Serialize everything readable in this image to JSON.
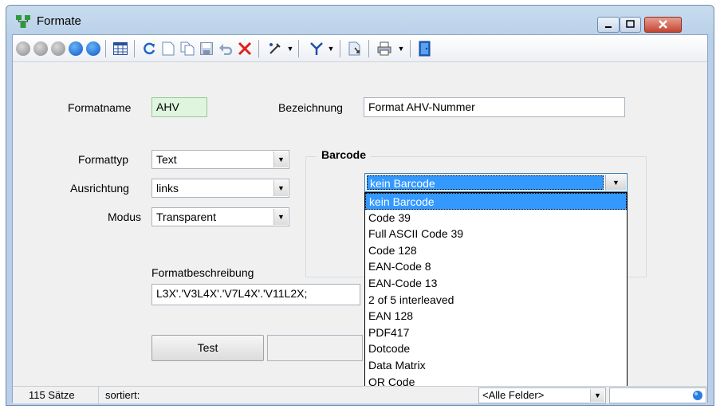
{
  "window": {
    "title": "Formate"
  },
  "toolbar": {
    "buttons": [
      "first-icon",
      "previous-page-icon",
      "previous-icon",
      "next-icon",
      "last-icon",
      "table-view-icon",
      "refresh-icon",
      "new-icon",
      "copy-icon",
      "save-icon",
      "undo-icon",
      "delete-icon",
      "edit-tool-icon",
      "filter-icon",
      "document-icon",
      "print-icon",
      "exit-icon"
    ]
  },
  "form": {
    "formatname_label": "Formatname",
    "formatname_value": "AHV",
    "bezeichnung_label": "Bezeichnung",
    "bezeichnung_value": "Format AHV-Nummer",
    "formattyp_label": "Formattyp",
    "formattyp_value": "Text",
    "ausrichtung_label": "Ausrichtung",
    "ausrichtung_value": "links",
    "modus_label": "Modus",
    "modus_value": "Transparent",
    "formatbeschreibung_label": "Formatbeschreibung",
    "formatbeschreibung_value": "L3X'.'V3L4X'.'V7L4X'.'V11L2X;",
    "test_button": "Test"
  },
  "barcode": {
    "group_title": "Barcode",
    "selected": "kein Barcode",
    "options": [
      "kein Barcode",
      "Code 39",
      "Full ASCII Code 39",
      "Code 128",
      "EAN-Code 8",
      "EAN-Code 13",
      "2 of 5 interleaved",
      "EAN 128",
      "PDF417",
      "Dotcode",
      "Data Matrix",
      "QR Code"
    ]
  },
  "status": {
    "count": "115 Sätze",
    "sorted": "sortiert:",
    "field_filter": "<Alle Felder>"
  }
}
